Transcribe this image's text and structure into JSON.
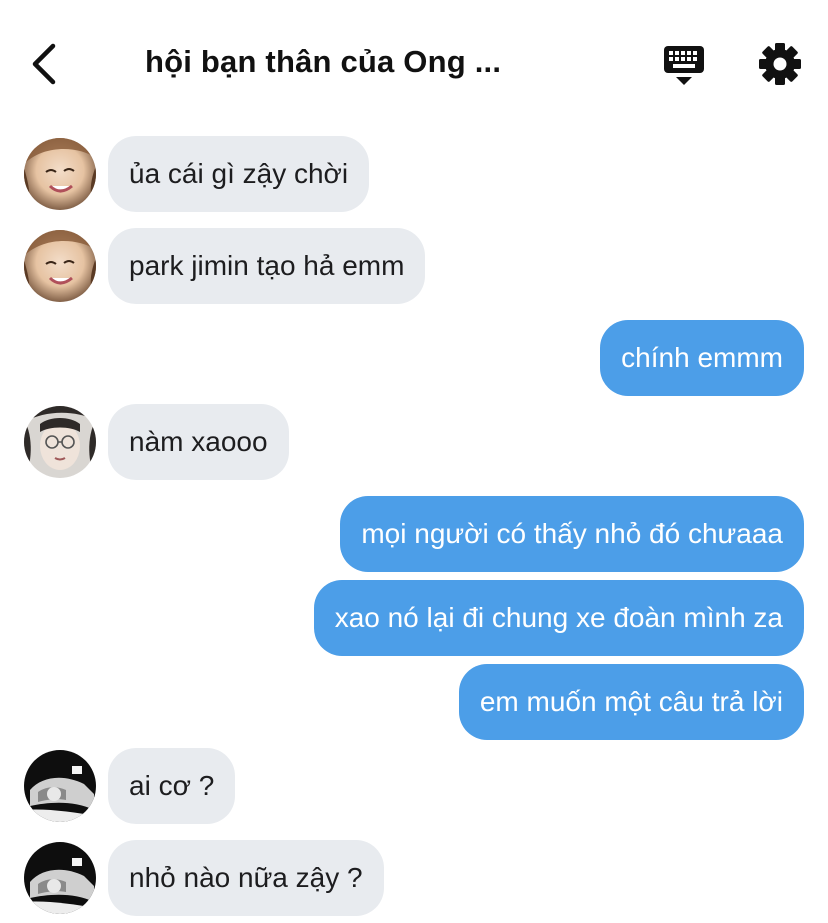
{
  "header": {
    "title": "hội bạn thân của Ong ...",
    "back_icon": "chevron-left-icon",
    "keyboard_icon": "keyboard-icon",
    "settings_icon": "gear-icon"
  },
  "colors": {
    "incoming_bubble": "#e8ebef",
    "outgoing_bubble": "#4c9ee8"
  },
  "messages": [
    {
      "sender": "other",
      "avatar": "avatar-1",
      "text": "ủa cái gì zậy chời"
    },
    {
      "sender": "other",
      "avatar": "avatar-1",
      "text": "park jimin tạo hả emm"
    },
    {
      "sender": "me",
      "text": "chính emmm"
    },
    {
      "sender": "other",
      "avatar": "avatar-2",
      "text": "nàm xaooo"
    },
    {
      "sender": "me",
      "text": "mọi người có thấy nhỏ đó chưaaa"
    },
    {
      "sender": "me",
      "text": "xao nó lại đi chung xe đoàn mình za"
    },
    {
      "sender": "me",
      "text": "em muốn một câu trả lời"
    },
    {
      "sender": "other",
      "avatar": "avatar-3",
      "text": "ai cơ ?"
    },
    {
      "sender": "other",
      "avatar": "avatar-3",
      "text": "nhỏ nào nữa zậy ?"
    }
  ]
}
